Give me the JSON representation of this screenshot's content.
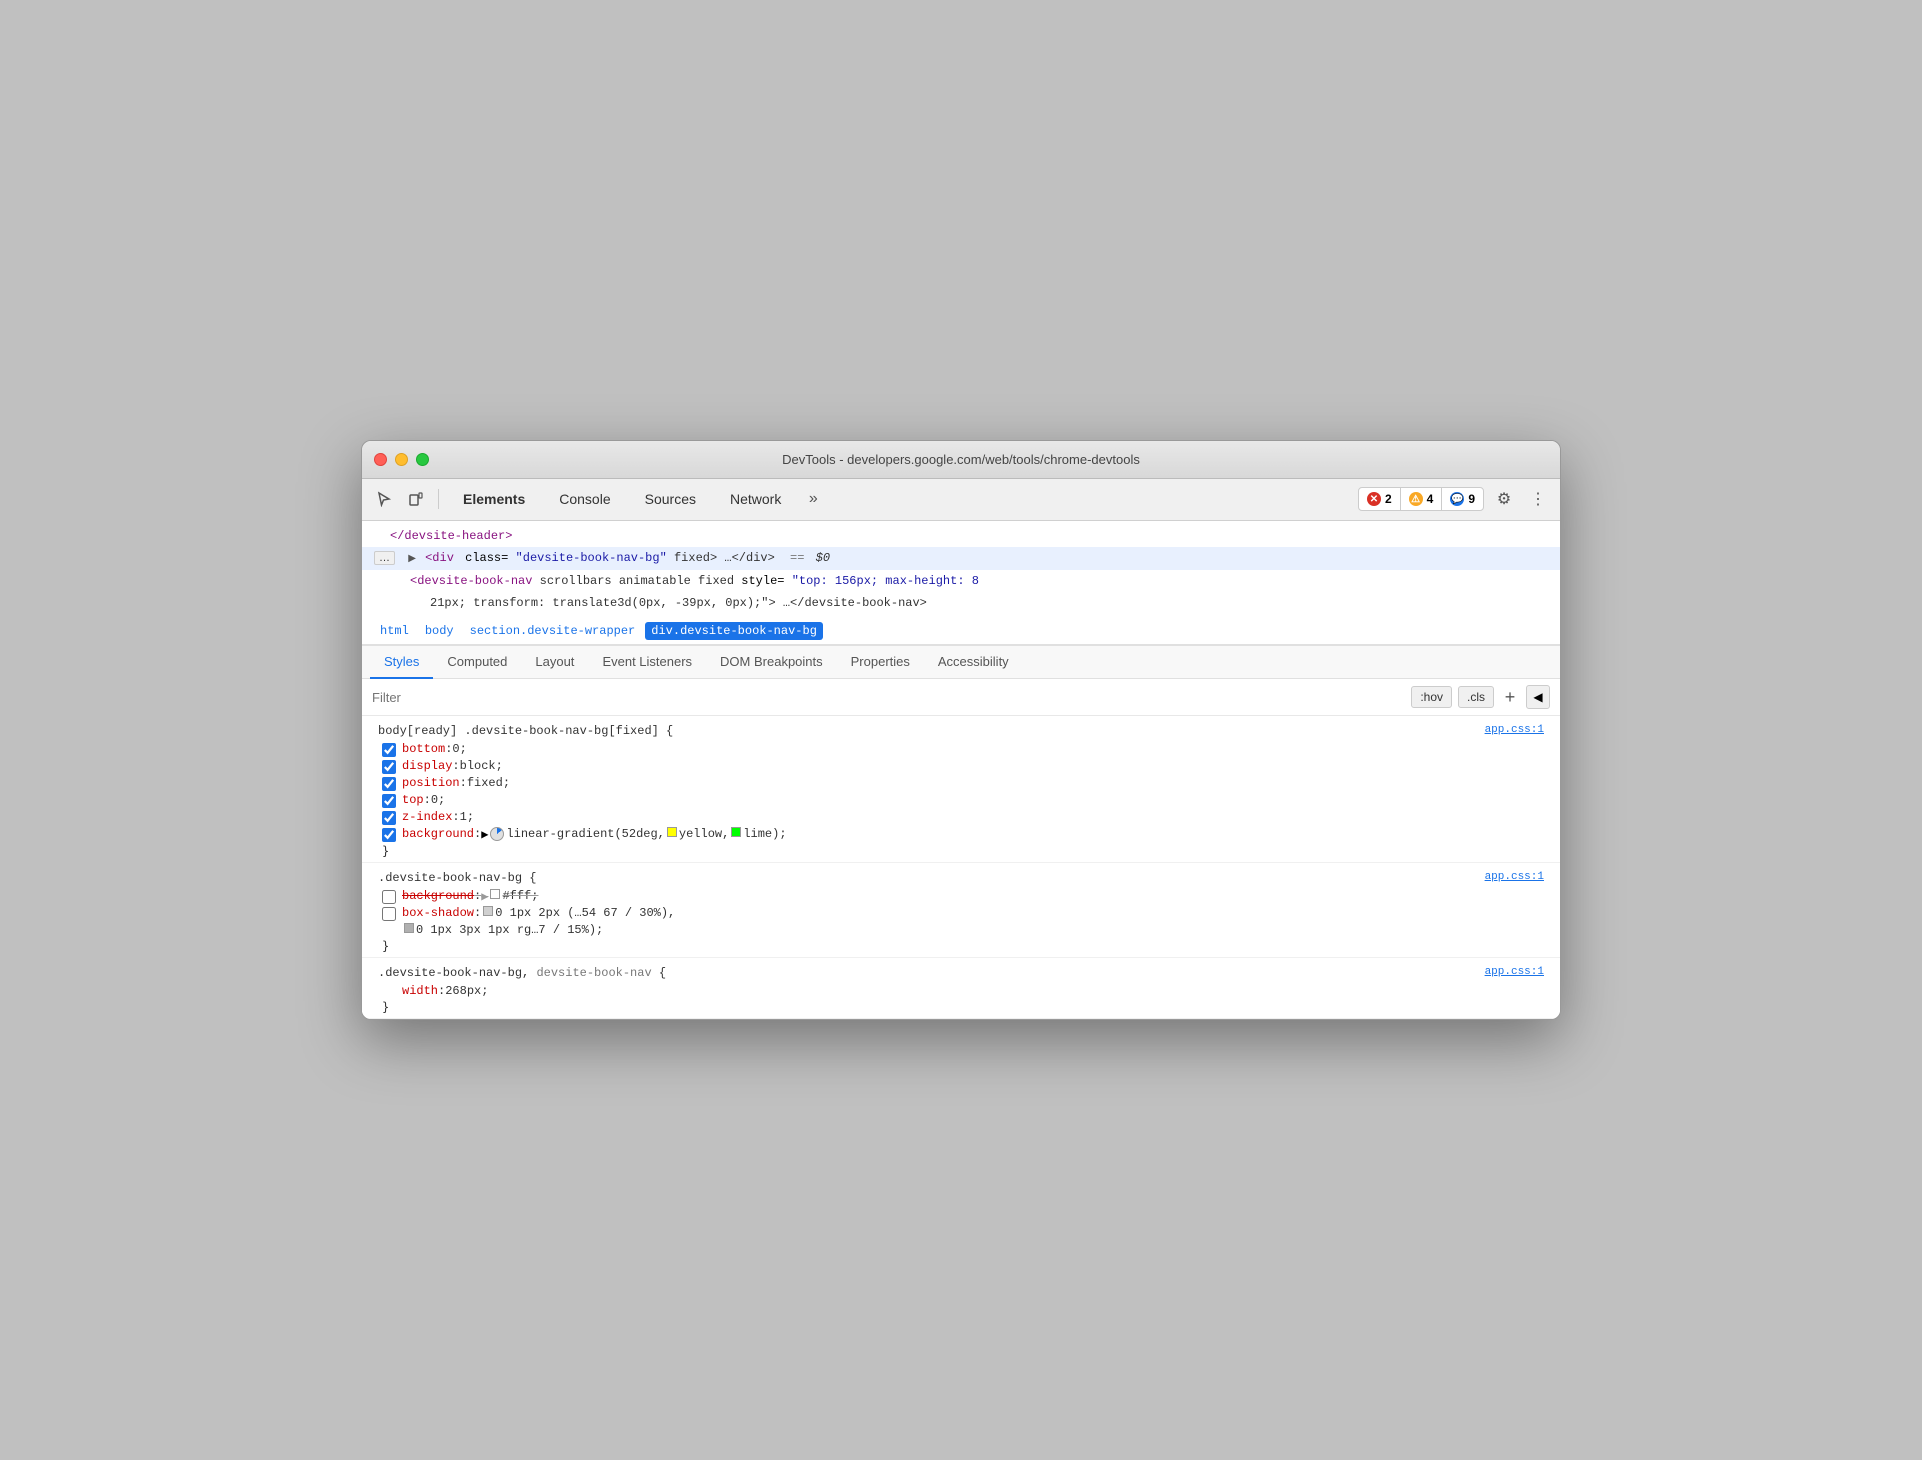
{
  "window": {
    "title": "DevTools - developers.google.com/web/tools/chrome-devtools"
  },
  "toolbar": {
    "tabs": [
      "Elements",
      "Console",
      "Sources",
      "Network"
    ],
    "more_label": "»",
    "error_count": "2",
    "warning_count": "4",
    "info_count": "9"
  },
  "html_panel": {
    "line1": "</devsite-header>",
    "line2_pre": "<div class=",
    "line2_class": "\"devsite-book-nav-bg\"",
    "line2_mid": " fixed>",
    "line2_ellipsis": "…",
    "line2_close": "</div>",
    "line2_eq": "== $0",
    "line3_open": "<devsite-book-nav scrollbars animatable fixed style=",
    "line3_style": "\"top: 156px; max-height: 8",
    "line4_indent": "21px; transform: translate3d(0px, -39px, 0px);\">",
    "line4_ellipsis": "…",
    "line4_close": "</devsite-book-nav>"
  },
  "breadcrumb": {
    "items": [
      "html",
      "body",
      "section.devsite-wrapper",
      "div.devsite-book-nav-bg"
    ]
  },
  "styles_panel": {
    "tabs": [
      "Styles",
      "Computed",
      "Layout",
      "Event Listeners",
      "DOM Breakpoints",
      "Properties",
      "Accessibility"
    ],
    "active_tab": "Styles",
    "filter_placeholder": "Filter",
    "hov_btn": ":hov",
    "cls_btn": ".cls",
    "add_btn": "+",
    "toggle_label": "◀"
  },
  "css_rules": [
    {
      "selector": "body[ready] .devsite-book-nav-bg[fixed] {",
      "source": "app.css:1",
      "properties": [
        {
          "name": "bottom",
          "value": "0;",
          "checked": true,
          "strikethrough": false
        },
        {
          "name": "display",
          "value": "block;",
          "checked": true,
          "strikethrough": false
        },
        {
          "name": "position",
          "value": "fixed;",
          "checked": true,
          "strikethrough": false
        },
        {
          "name": "top",
          "value": "0;",
          "checked": true,
          "strikethrough": false
        },
        {
          "name": "z-index",
          "value": "1;",
          "checked": true,
          "strikethrough": false
        },
        {
          "name": "background",
          "value": "linear-gradient(52deg, yellow, lime);",
          "checked": true,
          "strikethrough": false,
          "has_gradient": true,
          "has_angle": true
        }
      ]
    },
    {
      "selector": ".devsite-book-nav-bg {",
      "source": "app.css:1",
      "properties": [
        {
          "name": "background",
          "value": "#fff;",
          "checked": false,
          "strikethrough": true,
          "has_color": true,
          "color": "#ffffff"
        },
        {
          "name": "box-shadow",
          "value": "0 1px 2px (…54 67 / 30%),",
          "checked": false,
          "strikethrough": false,
          "has_swatch": true,
          "swatch_color": "#d0d0d0",
          "line2": "0 1px 3px 1px  rg…7 / 15%);",
          "has_swatch2": true
        }
      ]
    },
    {
      "selector": ".devsite-book-nav-bg, devsite-book-nav {",
      "source": "app.css:1",
      "properties": [
        {
          "name": "width",
          "value": "268px;",
          "checked": false,
          "strikethrough": false
        }
      ]
    }
  ],
  "angle_popup": {
    "visible": true,
    "angle": 52,
    "unit": "deg"
  }
}
